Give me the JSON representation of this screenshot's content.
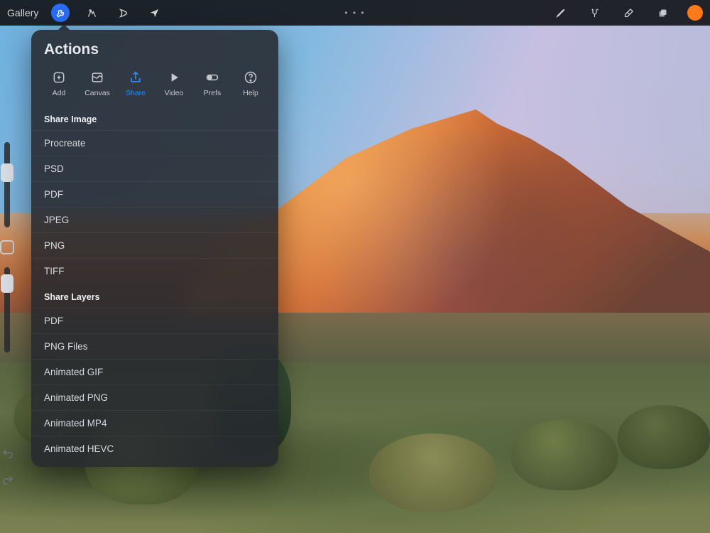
{
  "toolbar": {
    "gallery_label": "Gallery",
    "left_tools": [
      {
        "name": "actions-tool-icon",
        "active": true
      },
      {
        "name": "adjustments-tool-icon",
        "active": false
      },
      {
        "name": "selection-tool-icon",
        "active": false
      },
      {
        "name": "transform-tool-icon",
        "active": false
      }
    ],
    "center_dots": "• • •",
    "right_tools": [
      {
        "name": "brush-tool-icon"
      },
      {
        "name": "smudge-tool-icon"
      },
      {
        "name": "eraser-tool-icon"
      },
      {
        "name": "layers-tool-icon"
      },
      {
        "name": "color-swatch"
      }
    ],
    "swatch_color": "#ff7a1a"
  },
  "actions_panel": {
    "title": "Actions",
    "tabs": [
      {
        "id": "add",
        "label": "Add"
      },
      {
        "id": "canvas",
        "label": "Canvas"
      },
      {
        "id": "share",
        "label": "Share",
        "active": true
      },
      {
        "id": "video",
        "label": "Video"
      },
      {
        "id": "prefs",
        "label": "Prefs"
      },
      {
        "id": "help",
        "label": "Help"
      }
    ],
    "sections": [
      {
        "header": "Share Image",
        "items": [
          "Procreate",
          "PSD",
          "PDF",
          "JPEG",
          "PNG",
          "TIFF"
        ]
      },
      {
        "header": "Share Layers",
        "items": [
          "PDF",
          "PNG Files",
          "Animated GIF",
          "Animated PNG",
          "Animated MP4",
          "Animated HEVC"
        ]
      }
    ]
  }
}
